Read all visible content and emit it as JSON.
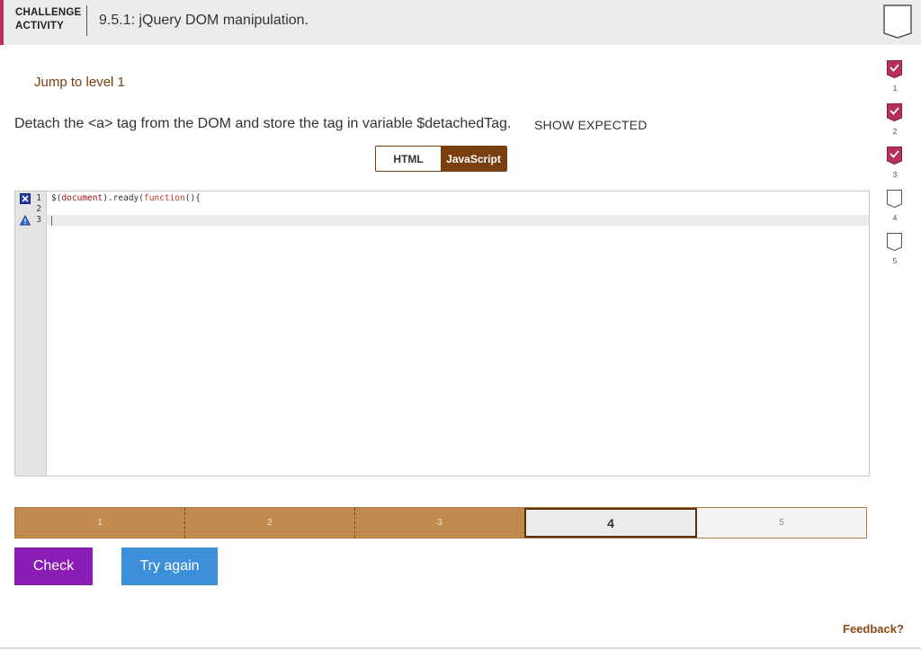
{
  "header": {
    "label": "CHALLENGE\nACTIVITY",
    "title": "9.5.1: jQuery DOM manipulation."
  },
  "jump_link": "Jump to level 1",
  "instructions": {
    "text": "Detach the <a> tag from the DOM and store the tag in variable $detachedTag.",
    "show_expected": "SHOW EXPECTED"
  },
  "language_toggle": {
    "options": [
      "HTML",
      "JavaScript"
    ],
    "selected": "JavaScript"
  },
  "editor": {
    "line_numbers": [
      "1",
      "2",
      "3"
    ],
    "line1": {
      "dollar": "$(",
      "doc": "document",
      "mid": ").ready(",
      "fn": "function",
      "end": "(){"
    },
    "line_markers": {
      "1": "error-icon",
      "3": "warning-icon"
    }
  },
  "levels": {
    "items": [
      "1",
      "2",
      "3",
      "4",
      "5"
    ],
    "current": "4",
    "completed": [
      "1",
      "2",
      "3"
    ]
  },
  "buttons": {
    "check": "Check",
    "try_again": "Try again"
  },
  "feedback": "Feedback?",
  "progress_sidebar": [
    {
      "label": "1",
      "status": "complete"
    },
    {
      "label": "2",
      "status": "complete"
    },
    {
      "label": "3",
      "status": "complete"
    },
    {
      "label": "4",
      "status": "incomplete"
    },
    {
      "label": "5",
      "status": "incomplete"
    }
  ],
  "colors": {
    "accent_brown": "#7a3f0e",
    "level_bar": "#c18a4e",
    "check_button": "#8a1db5",
    "try_again_button": "#3d8fd9",
    "complete_badge": "#b5305b"
  }
}
